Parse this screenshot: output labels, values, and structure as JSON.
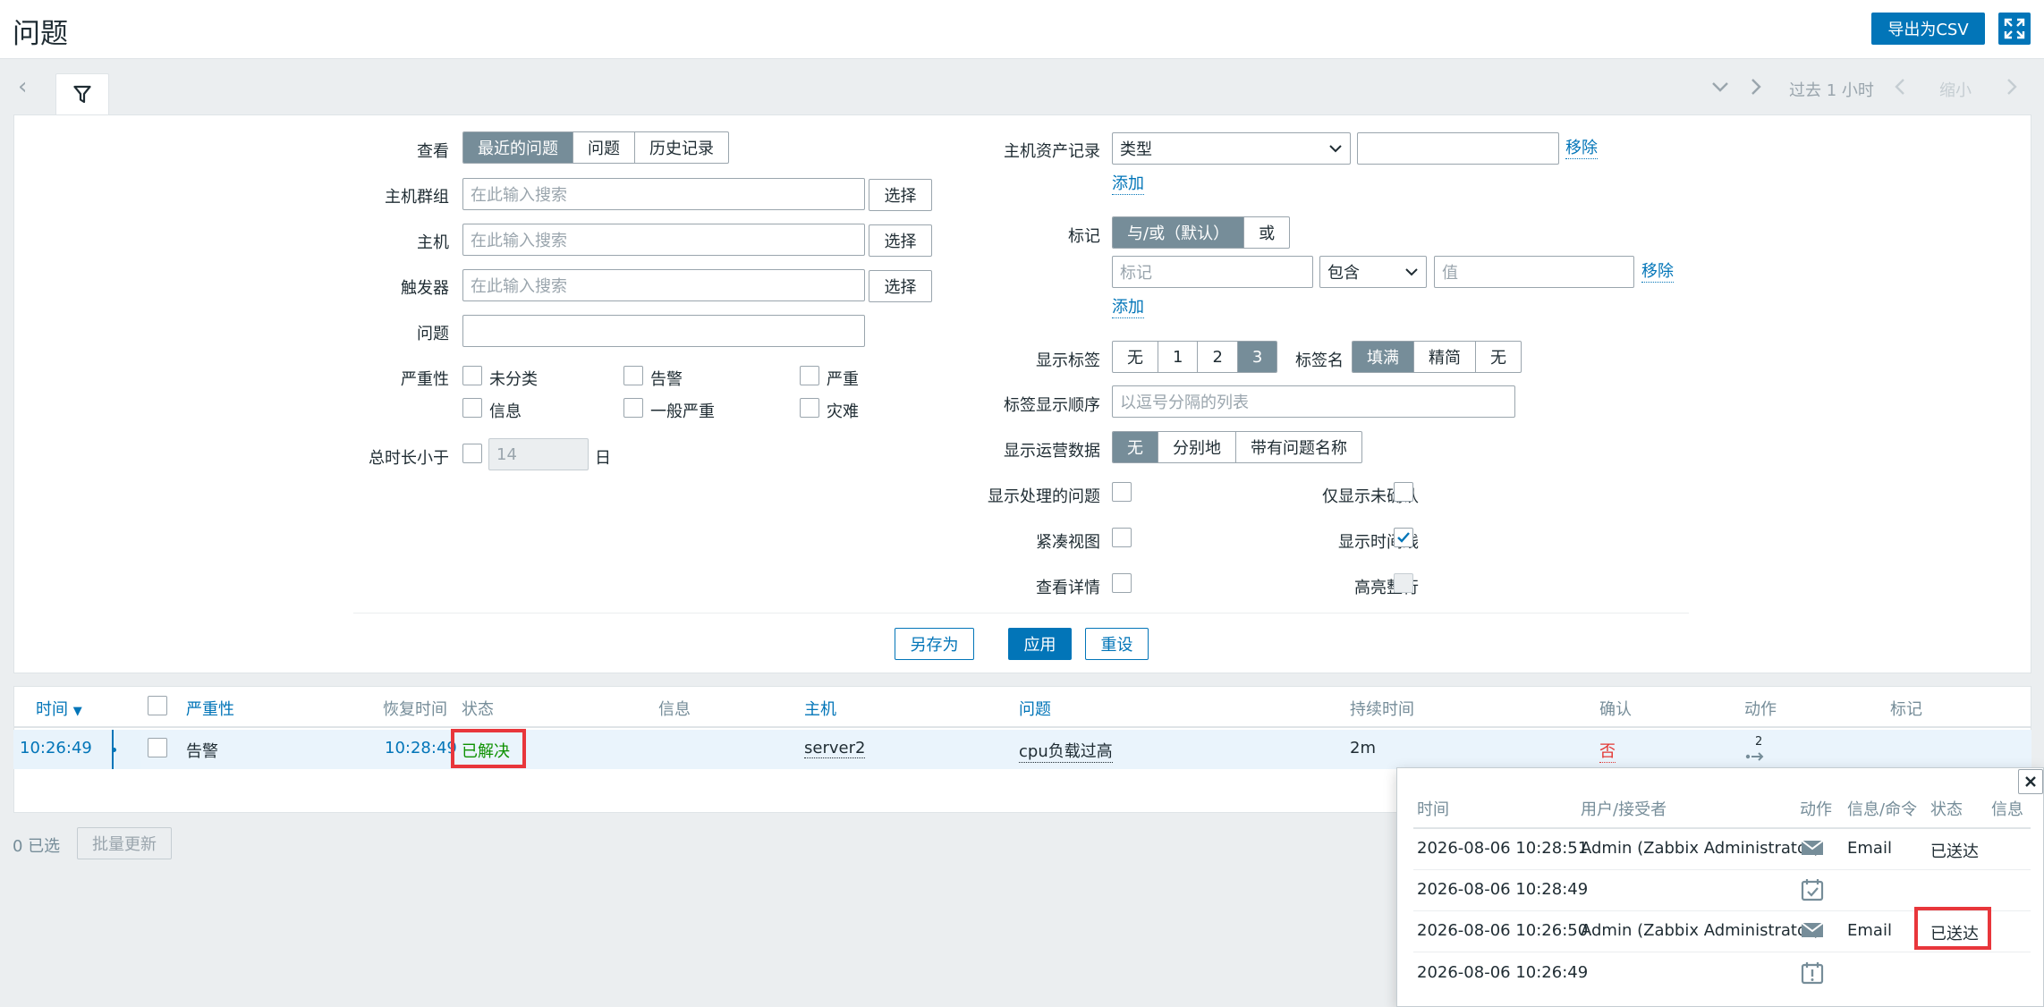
{
  "header": {
    "title": "问题",
    "export_label": "导出为CSV"
  },
  "timebar": {
    "period_label": "过去 1 小时",
    "zoom_out_label": "缩小"
  },
  "filter": {
    "view": {
      "label": "查看",
      "options": [
        "最近的问题",
        "问题",
        "历史记录"
      ],
      "selected": 0
    },
    "host_groups": {
      "label": "主机群组",
      "placeholder": "在此输入搜索",
      "select_label": "选择"
    },
    "hosts": {
      "label": "主机",
      "placeholder": "在此输入搜索",
      "select_label": "选择"
    },
    "triggers": {
      "label": "触发器",
      "placeholder": "在此输入搜索",
      "select_label": "选择"
    },
    "problem": {
      "label": "问题",
      "value": ""
    },
    "severity": {
      "label": "严重性",
      "options": [
        "未分类",
        "告警",
        "严重",
        "信息",
        "一般严重",
        "灾难"
      ]
    },
    "age": {
      "label": "总时长小于",
      "value": "14",
      "unit": "日"
    },
    "inventory": {
      "label": "主机资产记录",
      "field": "类型",
      "value": "",
      "remove_label": "移除",
      "add_label": "添加"
    },
    "tags": {
      "label": "标记",
      "operators": [
        "与/或（默认）",
        "或"
      ],
      "tag_placeholder": "标记",
      "condition": "包含",
      "value_placeholder": "值",
      "remove_label": "移除",
      "add_label": "添加"
    },
    "show_tags": {
      "label": "显示标签",
      "options": [
        "无",
        "1",
        "2",
        "3"
      ],
      "selected": 3
    },
    "tag_name": {
      "label": "标签名",
      "options": [
        "填满",
        "精简",
        "无"
      ],
      "selected": 0
    },
    "tag_priority": {
      "label": "标签显示顺序",
      "placeholder": "以逗号分隔的列表"
    },
    "show_opdata": {
      "label": "显示运营数据",
      "options": [
        "无",
        "分别地",
        "带有问题名称"
      ],
      "selected": 0
    },
    "show_suppressed": {
      "label": "显示处理的问题"
    },
    "unacknowledged": {
      "label": "仅显示未确认"
    },
    "compact_view": {
      "label": "紧凑视图"
    },
    "show_timeline": {
      "label": "显示时间线"
    },
    "details": {
      "label": "查看详情"
    },
    "highlight_row": {
      "label": "高亮整行"
    },
    "save_as_label": "另存为",
    "apply_label": "应用",
    "reset_label": "重设"
  },
  "table": {
    "columns": {
      "time": "时间",
      "severity": "严重性",
      "recovery_time": "恢复时间",
      "status": "状态",
      "info": "信息",
      "host": "主机",
      "problem": "问题",
      "duration": "持续时间",
      "ack": "确认",
      "actions": "动作",
      "tags": "标记"
    },
    "rows": [
      {
        "time": "10:26:49",
        "severity": "告警",
        "recovery_time": "10:28:49",
        "status": "已解决",
        "host": "server2",
        "problem": "cpu负载过高",
        "duration": "2m",
        "ack": "否",
        "actions_count": "2"
      }
    ]
  },
  "footer": {
    "selected_count": "0 已选",
    "mass_update_label": "批量更新"
  },
  "actions_popup": {
    "columns": [
      "时间",
      "用户/接受者",
      "动作",
      "信息/命令",
      "状态",
      "信息"
    ],
    "rows": [
      {
        "time": "2026-08-06 10:28:51",
        "user": "Admin (Zabbix Administrator)",
        "icon": "envelope-icon",
        "message": "Email",
        "status": "已送达"
      },
      {
        "time": "2026-08-06 10:28:49",
        "user": "",
        "icon": "calendar-check-icon",
        "message": "",
        "status": ""
      },
      {
        "time": "2026-08-06 10:26:50",
        "user": "Admin (Zabbix Administrator)",
        "icon": "envelope-icon",
        "message": "Email",
        "status": "已送达"
      },
      {
        "time": "2026-08-06 10:26:49",
        "user": "",
        "icon": "calendar-alert-icon",
        "message": "",
        "status": ""
      }
    ]
  },
  "colors": {
    "primary": "#0275b8",
    "selected_segment": "#768d99",
    "resolved": "#0d9100",
    "no_ack": "#e33734",
    "highlight": "#e8363b"
  }
}
